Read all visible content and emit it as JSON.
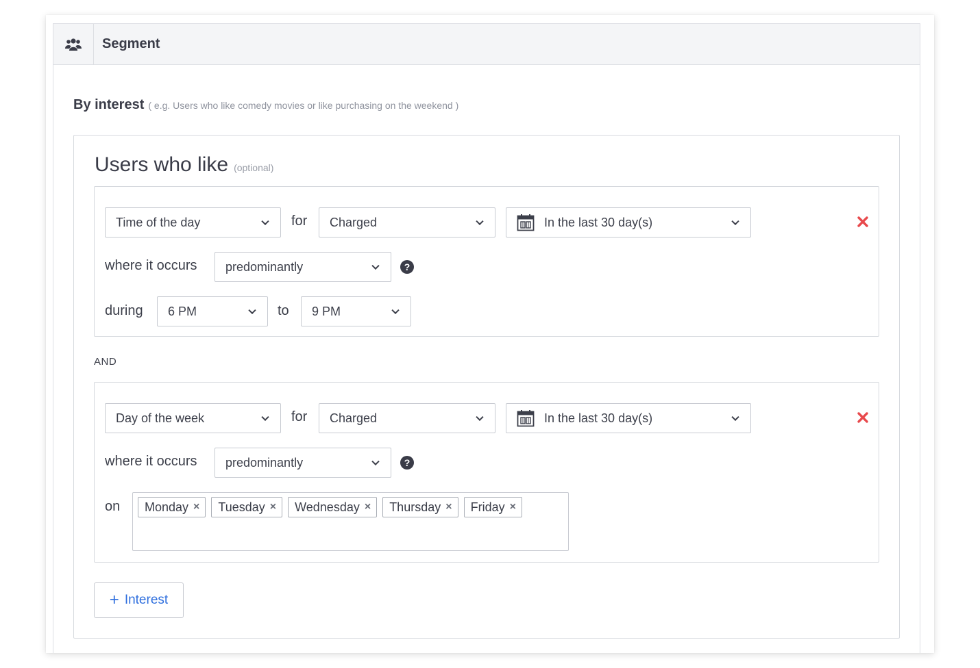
{
  "segment": {
    "title": "Segment",
    "icon": "users-icon"
  },
  "interest": {
    "label": "By interest",
    "hint": "( e.g. Users who like comedy movies or like purchasing on the weekend )",
    "box_title": "Users who like",
    "box_title_optional": "(optional)",
    "and_label": "AND",
    "add_button": {
      "plus": "+",
      "label": "Interest"
    },
    "rules": [
      {
        "attribute": "Time of the day",
        "for_label": "for",
        "event": "Charged",
        "date_range": "In the last 30 day(s)",
        "where_label": "where it occurs",
        "occurrence": "predominantly",
        "help": "?",
        "during_label": "during",
        "from": "6 PM",
        "to_label": "to",
        "to": "9 PM"
      },
      {
        "attribute": "Day of the week",
        "for_label": "for",
        "event": "Charged",
        "date_range": "In the last 30 day(s)",
        "where_label": "where it occurs",
        "occurrence": "predominantly",
        "help": "?",
        "on_label": "on",
        "days": [
          "Monday",
          "Tuesday",
          "Wednesday",
          "Thursday",
          "Friday"
        ],
        "tag_remove": "×"
      }
    ]
  },
  "colors": {
    "accent": "#2f6fde",
    "remove": "#e8494c",
    "border": "#c7cad1",
    "text": "#3c3f4a"
  }
}
